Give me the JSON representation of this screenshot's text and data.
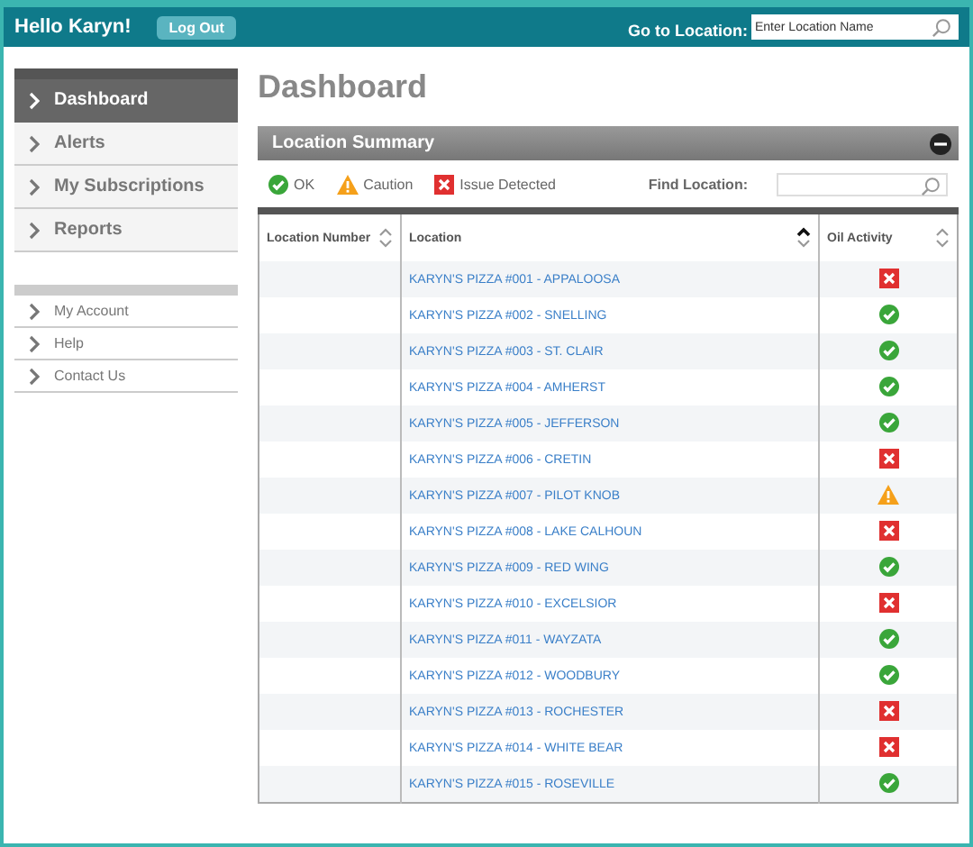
{
  "header": {
    "greeting": "Hello Karyn!",
    "logout_button": "Log Out",
    "location_search": {
      "label": "Go to Location:",
      "placeholder": "Enter Location Name"
    }
  },
  "sidebar": {
    "primary": [
      {
        "label": "Dashboard",
        "selected": true
      },
      {
        "label": "Alerts",
        "selected": false
      },
      {
        "label": "My Subscriptions",
        "selected": false
      },
      {
        "label": "Reports",
        "selected": false
      }
    ],
    "secondary": [
      {
        "label": "My Account"
      },
      {
        "label": "Help"
      },
      {
        "label": "Contact Us"
      }
    ]
  },
  "page_title": "Dashboard",
  "panel": {
    "title": "Location Summary",
    "legend": [
      {
        "kind": "ok",
        "label": "OK"
      },
      {
        "kind": "caution",
        "label": "Caution"
      },
      {
        "kind": "issue",
        "label": "Issue Detected"
      }
    ],
    "find_label": "Find Location:",
    "table": {
      "columns": [
        {
          "label": "Location Number",
          "sorted": false
        },
        {
          "label": "Location",
          "sorted": true
        },
        {
          "label": "Oil Activity",
          "sorted": false
        }
      ],
      "rows": [
        {
          "location": "KARYN'S PIZZA #001 - APPALOOSA",
          "kind": "issue"
        },
        {
          "location": "KARYN'S PIZZA #002 - SNELLING",
          "kind": "ok"
        },
        {
          "location": "KARYN'S PIZZA #003 - ST. CLAIR",
          "kind": "ok"
        },
        {
          "location": "KARYN'S PIZZA #004 - AMHERST",
          "kind": "ok"
        },
        {
          "location": "KARYN'S PIZZA #005 - JEFFERSON",
          "kind": "ok"
        },
        {
          "location": "KARYN'S PIZZA #006 - CRETIN",
          "kind": "issue"
        },
        {
          "location": "KARYN'S PIZZA #007 - PILOT KNOB",
          "kind": "caution"
        },
        {
          "location": "KARYN'S PIZZA #008 - LAKE CALHOUN",
          "kind": "issue"
        },
        {
          "location": "KARYN'S PIZZA #009 - RED WING",
          "kind": "ok"
        },
        {
          "location": "KARYN'S PIZZA #010 - EXCELSIOR",
          "kind": "issue"
        },
        {
          "location": "KARYN'S PIZZA #011 - WAYZATA",
          "kind": "ok"
        },
        {
          "location": "KARYN'S PIZZA #012 - WOODBURY",
          "kind": "ok"
        },
        {
          "location": "KARYN'S PIZZA #013 - ROCHESTER",
          "kind": "issue"
        },
        {
          "location": "KARYN'S PIZZA #014 - WHITE BEAR",
          "kind": "issue"
        },
        {
          "location": "KARYN'S PIZZA #015 - ROSEVILLE",
          "kind": "ok"
        }
      ]
    }
  }
}
